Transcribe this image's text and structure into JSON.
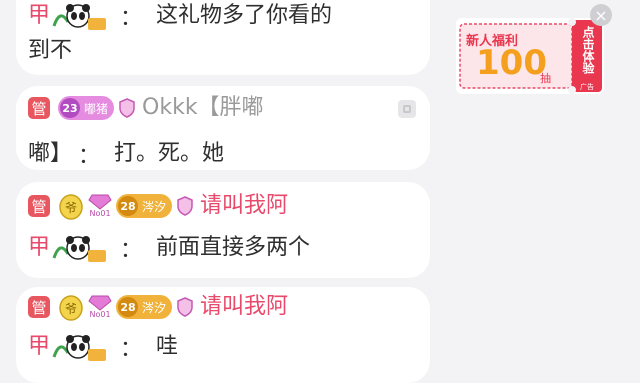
{
  "chat": {
    "messages": [
      {
        "role_char": "甲",
        "text_line1": "这礼物多了你看的",
        "text_line2": "到不"
      },
      {
        "manager_badge": "管",
        "level": "23",
        "fan_name": "嘟猪",
        "username": "Okkk【胖嘟",
        "text_line2_prefix": "嘟】",
        "text": "打。死。她"
      },
      {
        "manager_badge": "管",
        "rank_badge": "No01",
        "level": "28",
        "fan_name": "涔汐",
        "username": "请叫我阿",
        "role_char": "甲",
        "text": "前面直接多两个"
      },
      {
        "manager_badge": "管",
        "rank_badge": "No01",
        "level": "28",
        "fan_name": "涔汐",
        "username": "请叫我阿",
        "role_char": "甲",
        "text": "哇"
      }
    ],
    "colon": "："
  },
  "ad": {
    "title": "新人福利",
    "amount": "100",
    "unit": "抽",
    "cta": "点击体验",
    "tag": "广告",
    "close": "×"
  },
  "colors": {
    "manager": "#e8565f",
    "username": "#e84a6b",
    "level_pink": "#e58be0",
    "level_gold": "#f0b23a"
  }
}
